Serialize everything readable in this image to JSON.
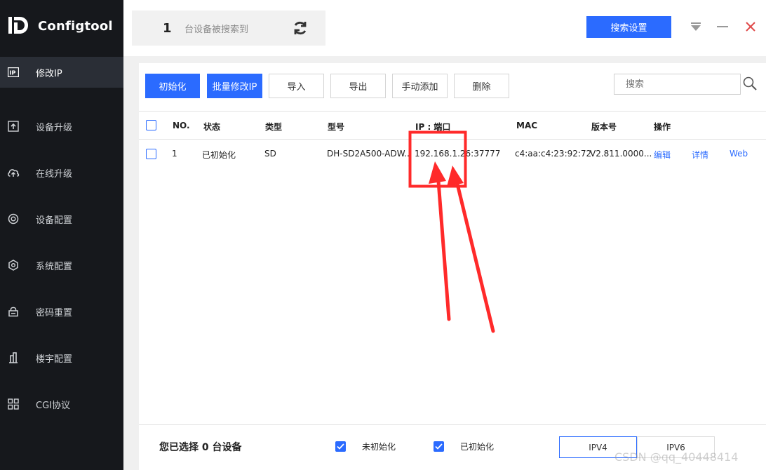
{
  "app": {
    "title": "Configtool"
  },
  "sidebar": {
    "items": [
      {
        "label": "修改IP",
        "icon": "ip-icon",
        "active": true
      },
      {
        "label": "设备升级",
        "icon": "upload-icon"
      },
      {
        "label": "在线升级",
        "icon": "cloud-upload-icon"
      },
      {
        "label": "设备配置",
        "icon": "target-icon"
      },
      {
        "label": "系统配置",
        "icon": "hexagon-settings-icon"
      },
      {
        "label": "密码重置",
        "icon": "lock-icon"
      },
      {
        "label": "楼宇配置",
        "icon": "building-icon"
      },
      {
        "label": "CGI协议",
        "icon": "grid-icon"
      }
    ]
  },
  "topbar": {
    "device_count": "1",
    "device_count_label": "台设备被搜索到",
    "search_settings_label": "搜索设置"
  },
  "toolbar": {
    "buttons": [
      "初始化",
      "批量修改IP",
      "导入",
      "导出",
      "手动添加",
      "删除"
    ],
    "search_placeholder": "搜索"
  },
  "table": {
    "columns": [
      "NO.",
      "状态",
      "类型",
      "型号",
      "IP : 端口",
      "MAC",
      "版本号",
      "操作"
    ],
    "rows": [
      {
        "no": "1",
        "status": "已初始化",
        "type": "SD",
        "model": "DH-SD2A500-ADW...",
        "ip_port": "192.168.1.26:37777",
        "mac": "c4:aa:c4:23:92:72",
        "version": "V2.811.0000...",
        "actions": [
          "编辑",
          "详情",
          "Web"
        ]
      }
    ]
  },
  "footer": {
    "selected_text": "您已选择 0 台设备",
    "filter_uninitialized": "未初始化",
    "filter_initialized": "已初始化",
    "tabs": [
      "IPV4",
      "IPV6"
    ]
  },
  "watermark": "CSDN @qq_40448414",
  "colors": {
    "accent": "#2b6bff",
    "sidebar_bg": "#16181c",
    "annotation_red": "#ff2a2a"
  }
}
